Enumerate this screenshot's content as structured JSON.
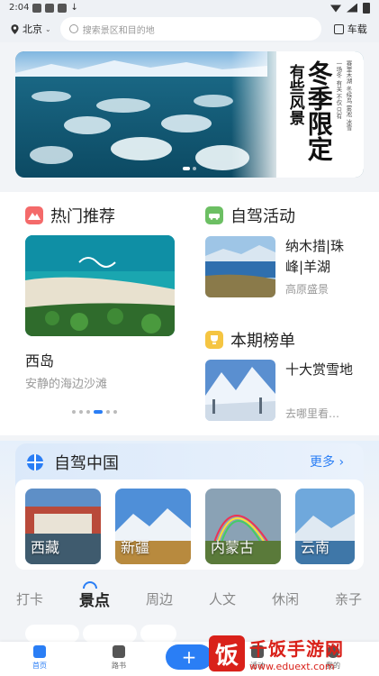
{
  "status": {
    "time": "2:04"
  },
  "header": {
    "city": "北京",
    "search_placeholder": "搜索景区和目的地",
    "scan_label": "车载"
  },
  "banner": {
    "slogan_main": "冬季限定",
    "slogan_side": "有些风景",
    "slogan_small": [
      "赛里木湖",
      "冬候鸟",
      "雾凇",
      "冰雪",
      "一场冬",
      "有关",
      "不仅",
      "只有"
    ]
  },
  "hot": {
    "title": "热门推荐",
    "name": "西岛",
    "subtitle": "安静的海边沙滩",
    "dots": 6,
    "active_dot": 3
  },
  "selfdrive_activity": {
    "title": "自驾活动",
    "item_title": "纳木措|珠峰|羊湖",
    "item_sub": "高原盛景"
  },
  "ranking": {
    "title": "本期榜单",
    "item_title": "十大赏雪地",
    "item_sub": "去哪里看…"
  },
  "zj_china": {
    "title": "自驾中国",
    "more": "更多",
    "regions": [
      "西藏",
      "新疆",
      "内蒙古",
      "云南"
    ]
  },
  "tabs": [
    "打卡",
    "景点",
    "周边",
    "人文",
    "休闲",
    "亲子"
  ],
  "active_tab": 1,
  "bottom_nav": [
    "首页",
    "路书",
    "+",
    "活动",
    "我的"
  ],
  "watermark": {
    "brand": "千饭手游网",
    "url": "www.eduext.com",
    "logo_char": "饭"
  },
  "colors": {
    "accent": "#2a7ef5",
    "watermark": "#d9211a"
  }
}
